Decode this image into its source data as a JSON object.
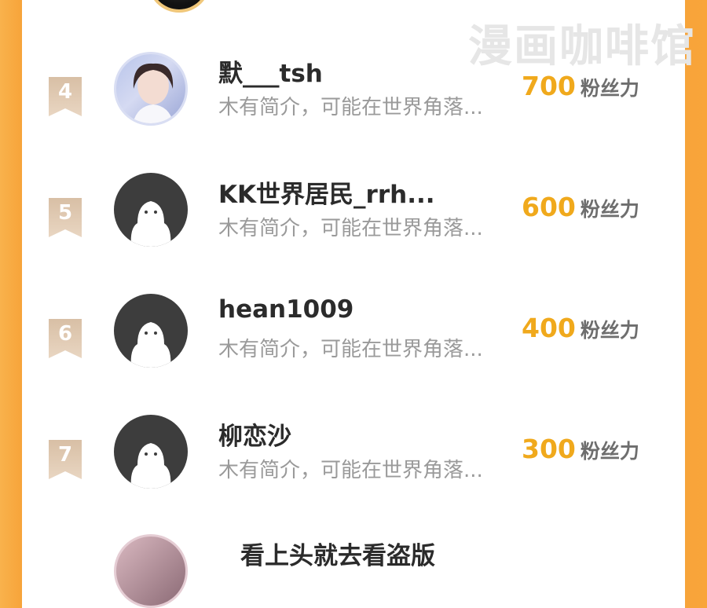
{
  "watermark": "漫画咖啡馆",
  "rows": [
    {
      "rank": "4",
      "name": "默___tsh",
      "desc": "木有简介，可能在世界角落...",
      "score": "700",
      "unit": "粉丝力"
    },
    {
      "rank": "5",
      "name": "KK世界居民_rrh...",
      "desc": "木有简介，可能在世界角落...",
      "score": "600",
      "unit": "粉丝力"
    },
    {
      "rank": "6",
      "name": "hean1009",
      "desc": "木有简介，可能在世界角落...",
      "score": "400",
      "unit": "粉丝力"
    },
    {
      "rank": "7",
      "name": "柳恋沙",
      "desc": "木有简介，可能在世界角落...",
      "score": "300",
      "unit": "粉丝力"
    }
  ],
  "next_row": {
    "name": "看上头就去看盗版"
  },
  "colors": {
    "accent": "#f0a91c",
    "side": "#f7a43a",
    "rank_badge": "#d8bfa5",
    "name": "#2b2b2b",
    "desc": "#9a9a9a"
  },
  "icons": {
    "default_avatar": "ghost-avatar-icon",
    "rank_badge": "ribbon-badge-icon"
  }
}
